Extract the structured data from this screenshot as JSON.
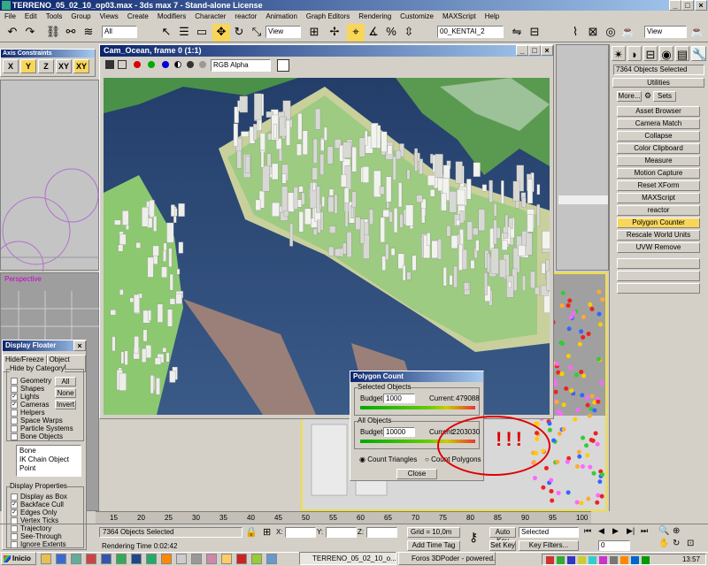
{
  "window": {
    "title": "TERRENO_05_02_10_op03.max - 3ds max 7  - Stand-alone License"
  },
  "menu": [
    "File",
    "Edit",
    "Tools",
    "Group",
    "Views",
    "Create",
    "Modifiers",
    "Character",
    "reactor",
    "Animation",
    "Graph Editors",
    "Rendering",
    "Customize",
    "MAXScript",
    "Help"
  ],
  "toolbar": {
    "selection_filter": "All",
    "ref_coord": "View",
    "named_selection": "00_KENTAI_2",
    "view_right": "View"
  },
  "axis_constraints": {
    "title": "Axis Constraints",
    "buttons": [
      "X",
      "Y",
      "Z",
      "XY",
      "XY"
    ]
  },
  "render_window": {
    "title": "Cam_Ocean, frame 0 (1:1)",
    "channel": "RGB Alpha"
  },
  "command_panel": {
    "selection_info": "7364 Objects Selected",
    "rollout_title": "Utilities",
    "more_label": "More...",
    "sets_label": "Sets",
    "utilities": [
      "Asset Browser",
      "Camera Match",
      "Collapse",
      "Color Clipboard",
      "Measure",
      "Motion Capture",
      "Reset XForm",
      "MAXScript",
      "reactor",
      "Polygon Counter",
      "Rescale World Units",
      "UVW Remove"
    ]
  },
  "viewport": {
    "perspective_label": "Perspective"
  },
  "display_floater": {
    "title": "Display Floater",
    "tabs": [
      "Hide/Freeze",
      "Object Level"
    ],
    "hide_by_category_label": "Hide by Category",
    "categories": [
      {
        "label": "Geometry",
        "checked": false
      },
      {
        "label": "Shapes",
        "checked": false
      },
      {
        "label": "Lights",
        "checked": true
      },
      {
        "label": "Cameras",
        "checked": true
      },
      {
        "label": "Helpers",
        "checked": false
      },
      {
        "label": "Space Warps",
        "checked": false
      },
      {
        "label": "Particle Systems",
        "checked": false
      },
      {
        "label": "Bone Objects",
        "checked": false
      }
    ],
    "buttons": [
      "All",
      "None",
      "Invert"
    ],
    "list_items": [
      "Bone",
      "IK Chain Object",
      "Point"
    ],
    "display_properties_label": "Display Properties",
    "properties": [
      {
        "label": "Display as Box",
        "checked": false
      },
      {
        "label": "Backface Cull",
        "checked": true
      },
      {
        "label": "Edges Only",
        "checked": true
      },
      {
        "label": "Vertex Ticks",
        "checked": false
      },
      {
        "label": "Trajectory",
        "checked": false
      },
      {
        "label": "See-Through",
        "checked": false
      },
      {
        "label": "Ignore Extents",
        "checked": false
      }
    ]
  },
  "polygon_count": {
    "title": "Polygon Count",
    "selected_group": "Selected Objects",
    "selected_budget_label": "Budget:",
    "selected_budget": "1000",
    "selected_current_label": "Current:",
    "selected_current": "479088",
    "all_group": "All Objects",
    "all_budget_label": "Budget:",
    "all_budget": "10000",
    "all_current_label": "Current:",
    "all_current": "2203030",
    "radio_triangles": "Count Triangles",
    "radio_polygons": "Count Polygons",
    "close_label": "Close",
    "annotation": "!!!"
  },
  "timeline": {
    "ticks": [
      "15",
      "20",
      "25",
      "30",
      "35",
      "40",
      "45",
      "50",
      "55",
      "60",
      "65",
      "70",
      "75",
      "80",
      "85",
      "90",
      "95",
      "100"
    ]
  },
  "status": {
    "objects_selected": "7364 Objects Selected",
    "rendering_time": "Rendering Time  0:02:42",
    "x_label": "X:",
    "y_label": "Y:",
    "z_label": "Z:",
    "grid": "Grid = 10,0m",
    "add_time_tag": "Add Time Tag",
    "auto_key": "Auto Key",
    "set_key": "Set Key",
    "key_mode": "Selected",
    "key_filters": "Key Filters...",
    "frame": "0"
  },
  "taskbar": {
    "start": "Inicio",
    "items": [
      "TERRENO_05_02_10_o...",
      "Foros 3DPoder - powered..."
    ],
    "clock": "13:57"
  }
}
